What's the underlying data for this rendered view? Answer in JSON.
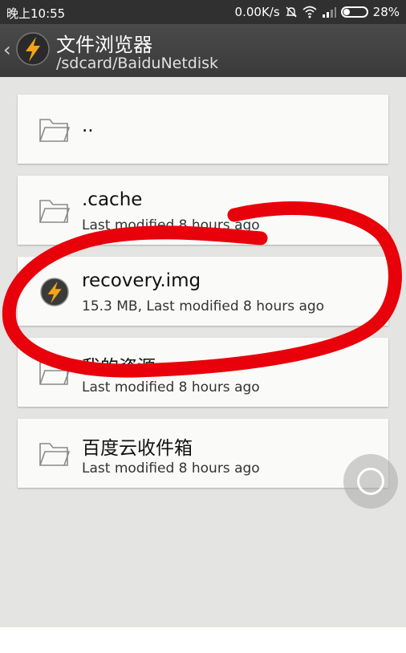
{
  "status_bar": {
    "time": "晚上10:55",
    "net_speed": "0.00K/s",
    "battery": "28%"
  },
  "action_bar": {
    "title": "文件浏览器",
    "path": "/sdcard/BaiduNetdisk",
    "back_glyph": "‹",
    "icons": {
      "back": "chevron-left-icon",
      "app": "lightning-bolt-icon"
    }
  },
  "files": [
    {
      "name": "..",
      "meta": "",
      "icon": "folder-icon"
    },
    {
      "name": ".cache",
      "meta": "Last modified 8 hours ago",
      "icon": "folder-icon"
    },
    {
      "name": "recovery.img",
      "meta": "15.3 MB, Last modified 8 hours ago",
      "icon": "lightning-bolt-icon"
    },
    {
      "name": "我的资源",
      "meta": "Last modified 8 hours ago",
      "icon": "folder-icon"
    },
    {
      "name": "百度云收件箱",
      "meta": "Last modified 8 hours ago",
      "icon": "folder-icon"
    }
  ],
  "colors": {
    "status_bar": "#303030",
    "action_bar": "#404040",
    "content_bg": "#e4e5e2",
    "card_bg": "#fafbf8",
    "annotation": "#e8000a"
  }
}
